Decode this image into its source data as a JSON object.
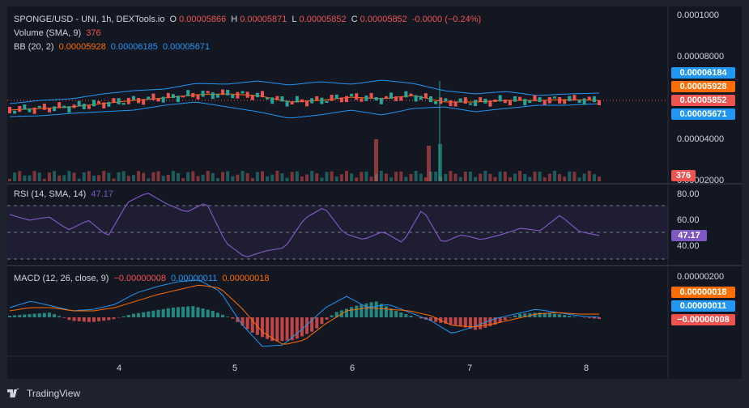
{
  "legend": {
    "symbol": "SPONGE/USD - UNI, 1h, DEXTools.io",
    "o_label": "O",
    "o_val": "0.00005866",
    "h_label": "H",
    "h_val": "0.00005871",
    "l_label": "L",
    "l_val": "0.00005852",
    "c_label": "C",
    "c_val": "0.00005852",
    "change": "-0.0000 (−0.24%)",
    "volume_label": "Volume (SMA, 9)",
    "volume_val": "376",
    "bb_label": "BB (20, 2)",
    "bb_basis": "0.00005928",
    "bb_upper": "0.00006185",
    "bb_lower": "0.00005671",
    "rsi_label": "RSI (14, SMA, 14)",
    "rsi_val": "47.17",
    "macd_label": "MACD (12, 26, close, 9)",
    "macd_hist": "−0.00000008",
    "macd_line": "0.00000011",
    "macd_signal": "0.00000018"
  },
  "price_axis": [
    "0.0001000",
    "0.00008000",
    "0.00004000",
    "0.00002000"
  ],
  "rsi_axis": [
    "80.00",
    "60.00",
    "40.00"
  ],
  "macd_axis": [
    "0.00000200"
  ],
  "time_axis": [
    "4",
    "5",
    "6",
    "7",
    "8"
  ],
  "tags": {
    "bb_upper": "0.00006184",
    "bb_basis": "0.00005928",
    "price": "0.00005852",
    "bb_lower": "0.00005671",
    "volume": "376",
    "rsi": "47.17",
    "macd_signal": "0.00000018",
    "macd_line": "0.00000011",
    "macd_hist": "−0.00000008"
  },
  "footer": {
    "brand": "TradingView"
  },
  "colors": {
    "up": "#26a69a",
    "down": "#ef5350",
    "bb_upper": "#2962ff",
    "bb_basis": "#ff6d00",
    "rsi": "#7e57c2",
    "macd": "#2962ff",
    "signal": "#ff6d00"
  }
}
